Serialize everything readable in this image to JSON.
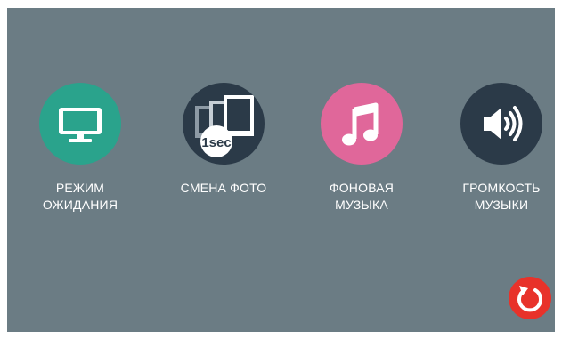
{
  "menu": {
    "items": [
      {
        "id": "standby",
        "line1": "РЕЖИМ",
        "line2": "ОЖИДАНИЯ",
        "icon": "monitor-icon",
        "color": "#2aa38c"
      },
      {
        "id": "photo",
        "line1": "СМЕНА ФОТО",
        "line2": "",
        "icon": "photo-stack-1sec-icon",
        "badge": "1sec",
        "color": "#2b3a48"
      },
      {
        "id": "music",
        "line1": "ФОНОВАЯ",
        "line2": "МУЗЫКА",
        "icon": "music-note-icon",
        "color": "#e0679a"
      },
      {
        "id": "volume",
        "line1": "ГРОМКОСТЬ",
        "line2": "МУЗЫКИ",
        "icon": "speaker-volume-icon",
        "color": "#2b3a48"
      }
    ]
  },
  "back_button": {
    "icon": "undo-arrow-icon",
    "color": "#e8322a"
  },
  "colors": {
    "screen_bg": "#6b7c84",
    "text": "#ffffff"
  }
}
